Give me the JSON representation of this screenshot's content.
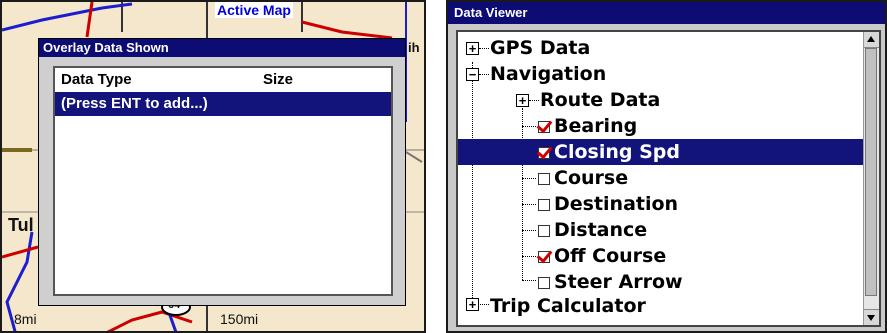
{
  "left_screen": {
    "map": {
      "active_map_label": "Active Map",
      "labels": [
        "Tul",
        "ih"
      ],
      "scale_left": "8mi",
      "scale_right": "150mi",
      "road_label": "64"
    },
    "overlay_dialog": {
      "title": "Overlay Data Shown",
      "columns": [
        "Data Type",
        "Size"
      ],
      "rows": [
        "(Press ENT to add...)"
      ]
    }
  },
  "right_screen": {
    "title": "Data Viewer",
    "tree": [
      {
        "label": "GPS Data",
        "type": "node",
        "expanded": false
      },
      {
        "label": "Navigation",
        "type": "node",
        "expanded": true
      },
      {
        "label": "Route Data",
        "type": "node",
        "expanded": false
      },
      {
        "label": "Bearing",
        "type": "leaf",
        "checked": true
      },
      {
        "label": "Closing Spd",
        "type": "leaf",
        "checked": true,
        "selected": true
      },
      {
        "label": "Course",
        "type": "leaf",
        "checked": false
      },
      {
        "label": "Destination",
        "type": "leaf",
        "checked": false
      },
      {
        "label": "Distance",
        "type": "leaf",
        "checked": false
      },
      {
        "label": "Off Course",
        "type": "leaf",
        "checked": true
      },
      {
        "label": "Steer Arrow",
        "type": "leaf",
        "checked": false
      },
      {
        "label": "Trip Calculator",
        "type": "node",
        "expanded": false
      }
    ]
  },
  "colors": {
    "title_bar": "#0c0c74",
    "selection": "#13137c",
    "check_mark": "#d00000",
    "map_bg": "#f4e7cb"
  },
  "icons": [
    "expand-plus-icon",
    "collapse-minus-icon",
    "checkbox-checked-icon",
    "checkbox-empty-icon",
    "scroll-up-arrow-icon",
    "scroll-down-arrow-icon"
  ]
}
